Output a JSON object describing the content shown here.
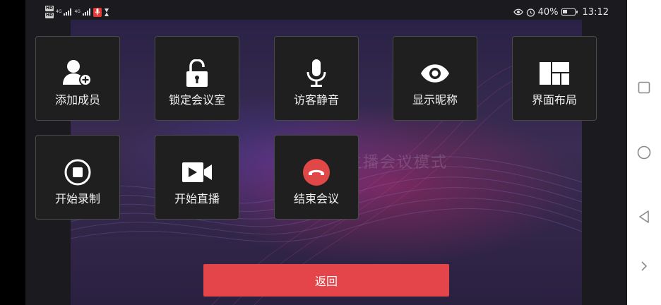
{
  "status_bar": {
    "hd_badges": [
      "HD",
      "HD"
    ],
    "signal_1": "4G",
    "signal_2": "4G",
    "battery_percent": "40%",
    "battery_level": 0.4,
    "time": "13:12",
    "icons": [
      "hd-icon",
      "signal-icon",
      "mic-recording-icon",
      "hourglass-icon",
      "eye-protection-icon",
      "alarm-icon",
      "battery-icon"
    ]
  },
  "background": {
    "watermark_text": "当前为主播会议模式"
  },
  "menu": {
    "tiles": [
      {
        "label": "添加成员",
        "icon": "add-member-icon"
      },
      {
        "label": "锁定会议室",
        "icon": "unlock-icon"
      },
      {
        "label": "访客静音",
        "icon": "microphone-icon"
      },
      {
        "label": "显示昵称",
        "icon": "eye-icon"
      },
      {
        "label": "界面布局",
        "icon": "layout-grid-icon"
      },
      {
        "label": "开始录制",
        "icon": "record-stop-icon"
      },
      {
        "label": "开始直播",
        "icon": "video-camera-icon"
      },
      {
        "label": "结束会议",
        "icon": "hang-up-icon"
      }
    ]
  },
  "footer": {
    "back_label": "返回"
  },
  "colors": {
    "accent_red": "#e3454b",
    "hangup_red": "#e04848",
    "tile_bg": "#1f1f1f",
    "tile_border": "#4a4a4a"
  },
  "nav_bar": {
    "buttons": [
      "recents-square-icon",
      "home-circle-icon",
      "back-triangle-icon",
      "expand-chevron-icon"
    ]
  }
}
